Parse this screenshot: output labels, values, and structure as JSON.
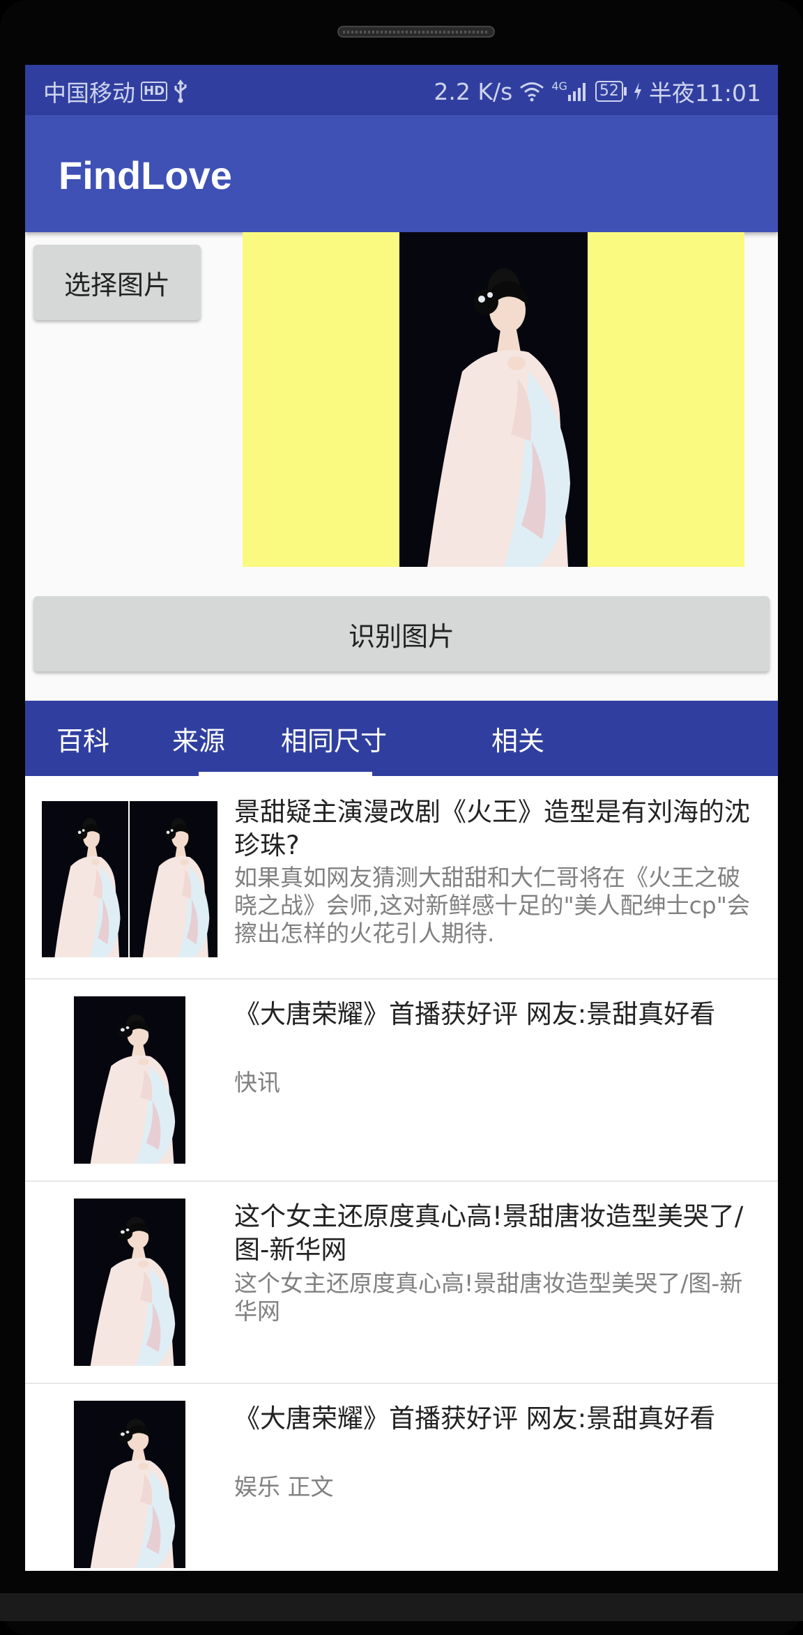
{
  "status_bar": {
    "carrier": "中国移动",
    "hd_badge": "HD",
    "usb_icon": "usb-icon",
    "speed": "2.2 K/s",
    "network": "4G",
    "battery": "52",
    "time": "半夜11:01"
  },
  "app": {
    "title": "FindLove"
  },
  "actions": {
    "pick_label": "选择图片",
    "recognize_label": "识别图片"
  },
  "colors": {
    "status_bar": "#303f9f",
    "app_bar": "#3f51b5",
    "preview_bg": "#fafa80"
  },
  "tabs": [
    {
      "label": "百科"
    },
    {
      "label": "来源",
      "selected": true
    },
    {
      "label": "相同尺寸"
    },
    {
      "label": "相关"
    }
  ],
  "results": [
    {
      "title": "景甜疑主演漫改剧《火王》造型是有刘海的沈珍珠?",
      "desc": "如果真如网友猜测大甜甜和大仁哥将在《火王之破晓之战》会师,这对新鲜感十足的\"美人配绅士cp\"会擦出怎样的火花引人期待."
    },
    {
      "title": "《大唐荣耀》首播获好评 网友:景甜真好看",
      "desc": "快讯"
    },
    {
      "title": "这个女主还原度真心高!景甜唐妆造型美哭了/图-新华网",
      "desc": "这个女主还原度真心高!景甜唐妆造型美哭了/图-新华网"
    },
    {
      "title": "《大唐荣耀》首播获好评 网友:景甜真好看",
      "desc": "娱乐 正文"
    }
  ]
}
